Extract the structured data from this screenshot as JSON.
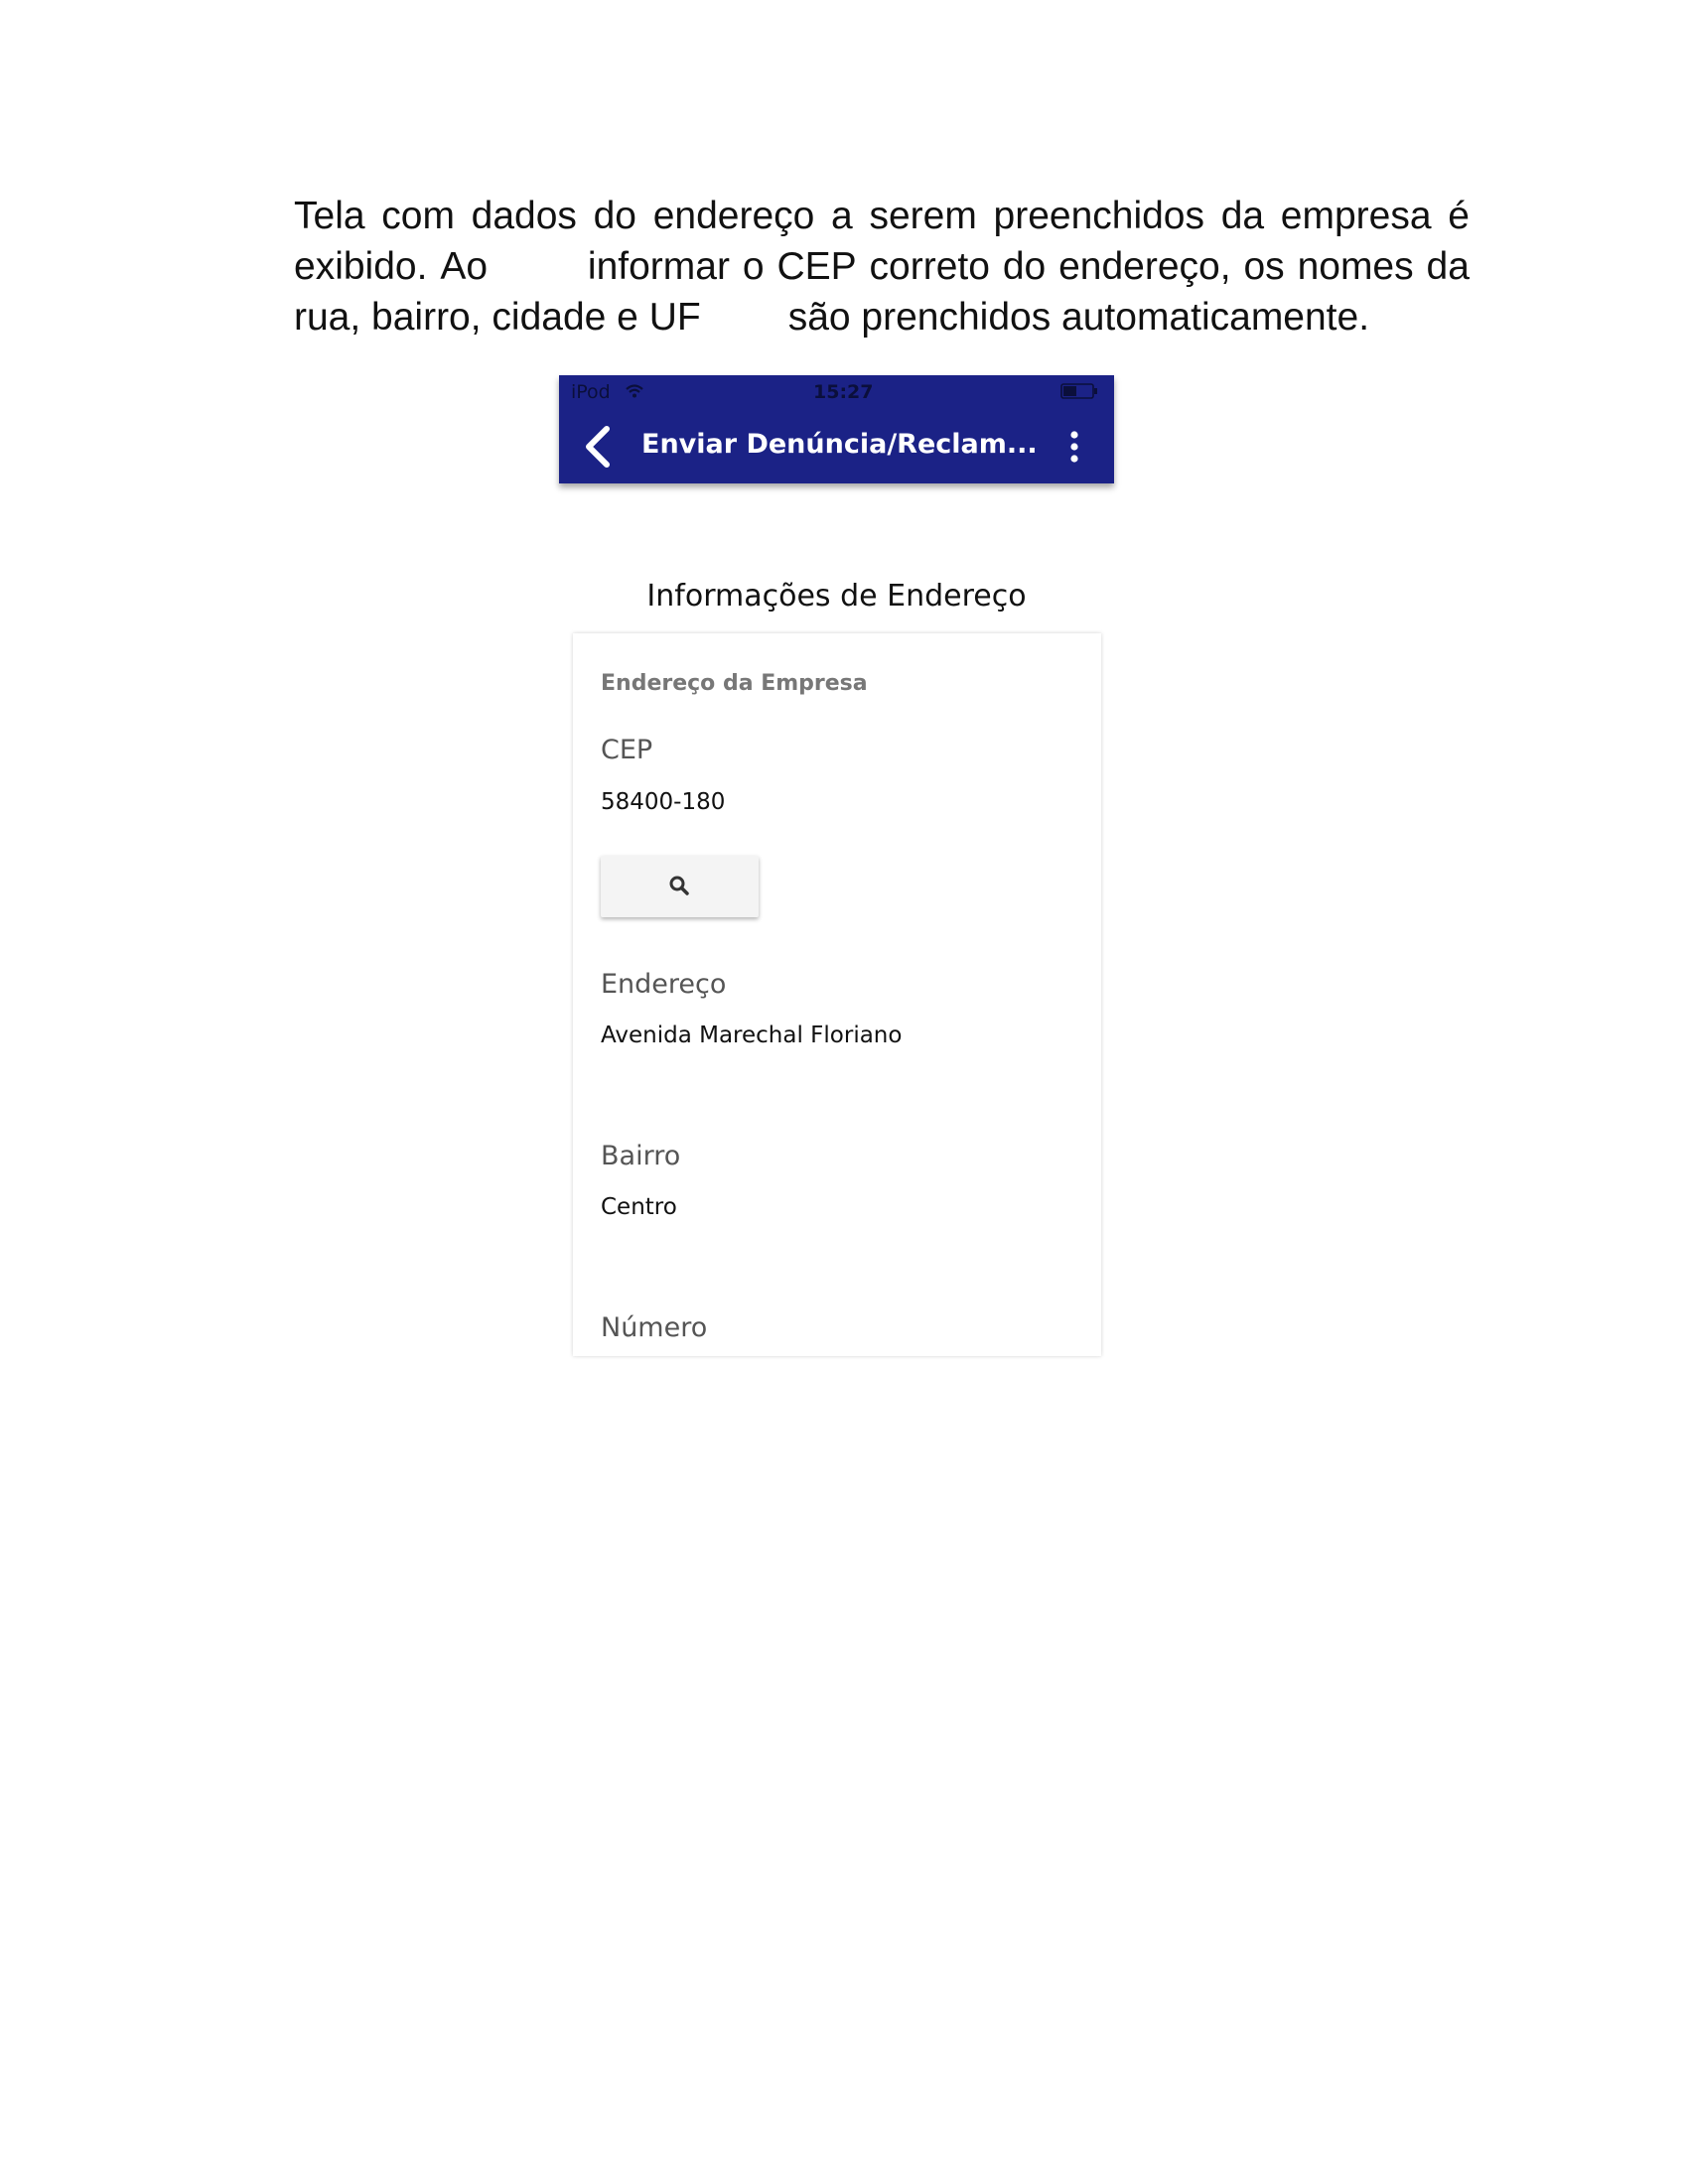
{
  "intro": {
    "line1": [
      "Tela",
      "com",
      "dados",
      "do",
      "endereço",
      "a",
      "serem",
      "preenchidos",
      "da",
      "empresa",
      "é"
    ],
    "line2_a": [
      "exibido.",
      "Ao"
    ],
    "line2_b": [
      "informar",
      "o",
      "CEP",
      "correto",
      "do",
      "endereço,",
      "os",
      "nomes",
      "da"
    ],
    "line3_a": "rua, bairro, cidade e UF",
    "line3_b": "são prenchidos automaticamente."
  },
  "status_bar": {
    "carrier": "iPod",
    "time": "15:27"
  },
  "app_bar": {
    "title": "Enviar Denúncia/Reclam..."
  },
  "colors": {
    "app_bar": "#1b2286"
  },
  "section_title": "Informações de Endereço",
  "card": {
    "header": "Endereço da Empresa",
    "cep": {
      "label": "CEP",
      "value": "58400-180"
    },
    "endereco": {
      "label": "Endereço",
      "value": "Avenida Marechal Floriano"
    },
    "bairro": {
      "label": "Bairro",
      "value": "Centro"
    },
    "numero": {
      "label": "Número"
    }
  }
}
